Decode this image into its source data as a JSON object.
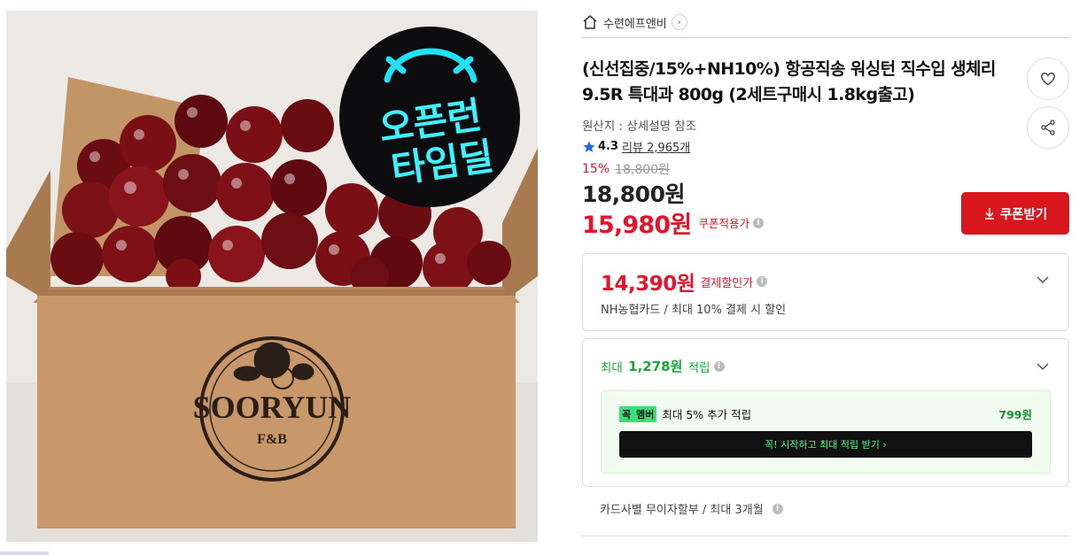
{
  "image": {
    "badge_line1": "오픈런",
    "badge_line2": "타임딜",
    "brand_logo_text": "SOORYUN",
    "brand_logo_sub": "F&B"
  },
  "store": {
    "name": "수련에프앤비",
    "arrow": "›"
  },
  "product": {
    "title": "(신선집중/15%+NH10%) 항공직송 워싱턴 직수입 생체리 9.5R 특대과 800g (2세트구매시 1.8kg출고)",
    "origin": "원산지 : 상세설명 참조",
    "rating": "4.3",
    "review_label": "리뷰 2,965개",
    "discount_pct": "15%",
    "original_price": "18,800원",
    "price": "18,800원",
    "coupon_price": "15,980원",
    "coupon_note": "쿠폰적용가"
  },
  "buttons": {
    "coupon": "쿠폰받기"
  },
  "payment_discount": {
    "price": "14,390원",
    "label": "결제할인가",
    "detail": "NH농협카드 / 최대 10% 결제 시 할인"
  },
  "points": {
    "prefix": "최대",
    "amount": "1,278원",
    "suffix": "적립",
    "member_badge_a": "꼭",
    "member_badge_b": "멤버",
    "member_text": "최대 5% 추가 적립",
    "member_points": "799원",
    "member_cta": "꼭! 시작하고 최대 적립 받기 ›"
  },
  "installment": "카드사별 무이자할부 / 최대 3개월",
  "colors": {
    "accent_red": "#e4142b",
    "coupon_button": "#d7161e",
    "points_green": "#17a83a"
  }
}
